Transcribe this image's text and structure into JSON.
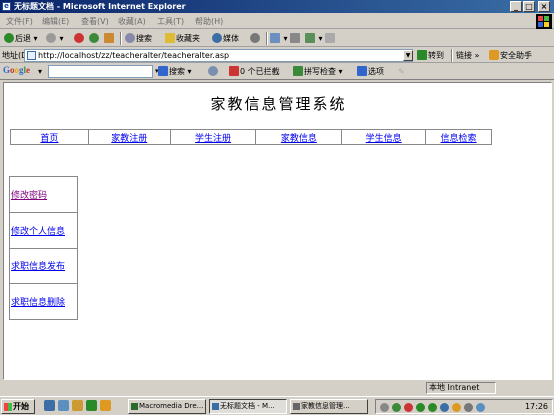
{
  "window": {
    "title": "无标题文档 - Microsoft Internet Explorer",
    "controls": [
      "_",
      "□",
      "×"
    ]
  },
  "menubar": {
    "items": [
      "文件(F)",
      "编辑(E)",
      "查看(V)",
      "收藏(A)",
      "工具(T)",
      "帮助(H)"
    ]
  },
  "toolbar": {
    "back_label": "后退",
    "search_label": "搜索",
    "favorites_label": "收藏夹",
    "media_label": "媒体"
  },
  "addressbar": {
    "label": "地址(D)",
    "url": "http://localhost/zz/teacheralter/teacheralter.asp",
    "go_label": "转到",
    "links_label": "链接",
    "safety_label": "安全助手"
  },
  "googlebar": {
    "logo": "Google",
    "search_label": "搜索",
    "blocked_label": "0 个已拦截",
    "spellcheck_label": "拼写检查",
    "options_label": "选项"
  },
  "page": {
    "site_title": "家教信息管理系统",
    "nav": [
      "首页",
      "家教注册",
      "学生注册",
      "家教信息",
      "学生信息",
      "信息检索"
    ],
    "side": [
      "修改密码",
      "修改个人信息",
      "求职信息发布",
      "求职信息删除"
    ]
  },
  "statusbar": {
    "zone_label": "本地 Intranet"
  },
  "taskbar": {
    "start_label": "开始",
    "tasks": [
      "Macromedia Dre...",
      "无标题文档 - M...",
      "家教信息管理..."
    ],
    "clock": "17:26"
  }
}
